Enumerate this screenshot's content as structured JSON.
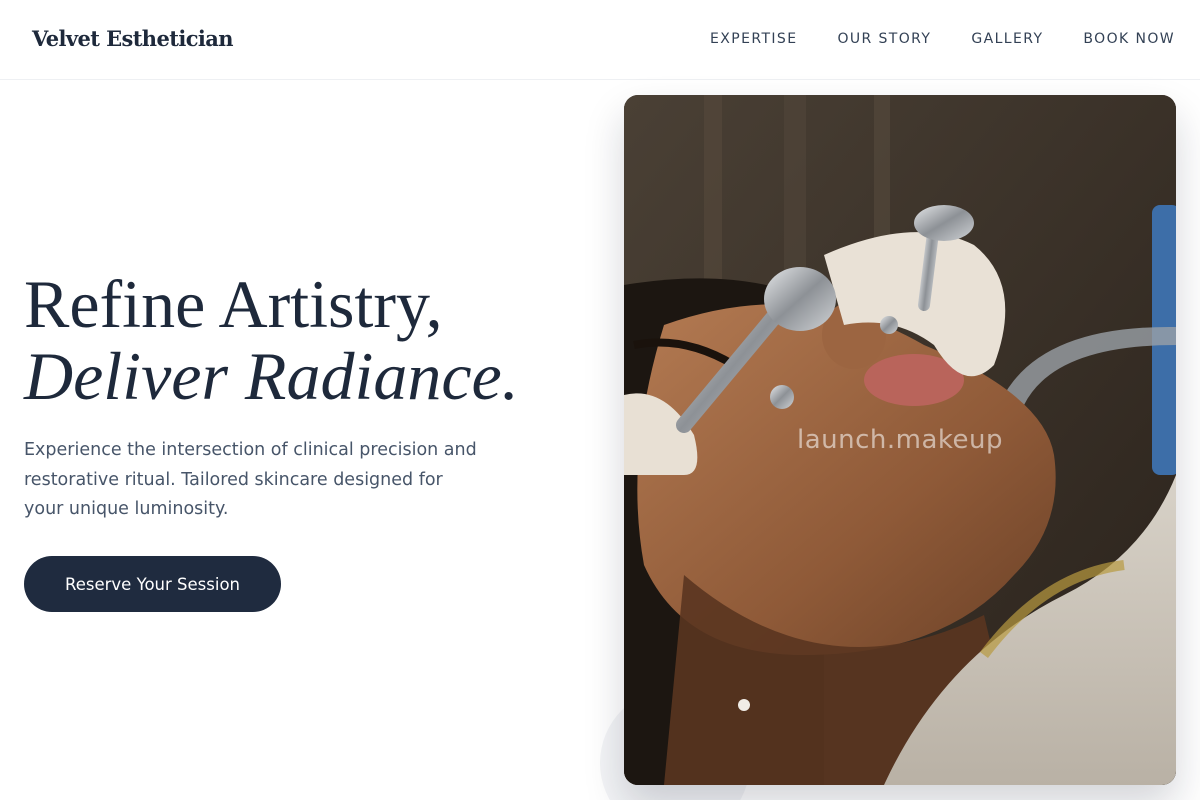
{
  "header": {
    "logo": "Velvet Esthetician",
    "nav": [
      {
        "label": "EXPERTISE"
      },
      {
        "label": "OUR STORY"
      },
      {
        "label": "GALLERY"
      },
      {
        "label": "BOOK NOW"
      }
    ]
  },
  "hero": {
    "headline_line1": "Refine Artistry,",
    "headline_line2": "Deliver Radiance.",
    "subtext": "Experience the intersection of clinical precision and restorative ritual. Tailored skincare designed for your unique luminosity.",
    "cta_label": "Reserve Your Session",
    "image_watermark": "launch.makeup"
  },
  "colors": {
    "primary": "#1e293b",
    "button": "#1f2b3f",
    "body_text": "#475569"
  }
}
